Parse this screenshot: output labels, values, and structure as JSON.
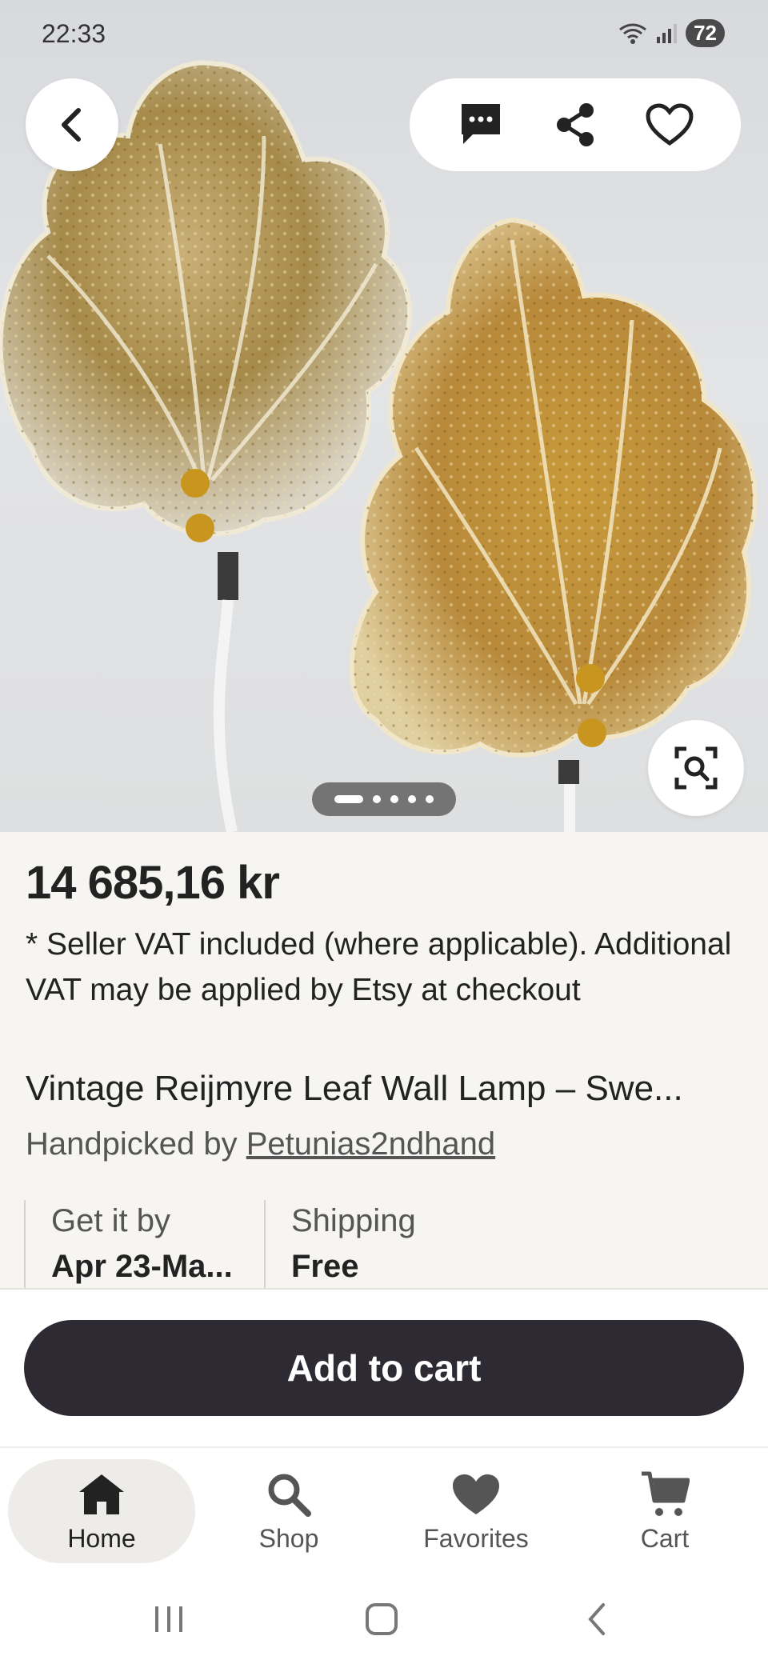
{
  "status_bar": {
    "time": "22:33",
    "battery": "72",
    "icons": [
      "wifi-icon",
      "signal-icon"
    ]
  },
  "top_actions": {
    "back_icon": "chevron-left-icon",
    "message_icon": "message-icon",
    "share_icon": "share-icon",
    "favorite_icon": "heart-outline-icon"
  },
  "gallery": {
    "image_count": 5,
    "current_index": 1,
    "zoom_icon": "visual-search-icon"
  },
  "listing": {
    "price": "14 685,16 kr",
    "vat_note": "* Seller VAT included (where applicable). Additional VAT may be applied by Etsy at checkout",
    "title": "Vintage Reijmyre Leaf Wall Lamp – Swe...",
    "handpicked_prefix": "Handpicked by ",
    "shop_name": "Petunias2ndhand"
  },
  "delivery": {
    "get_it_label": "Get it by",
    "get_it_value": "Apr 23-Ma...",
    "shipping_label": "Shipping",
    "shipping_value": "Free"
  },
  "cart": {
    "add_label": "Add to cart"
  },
  "bottom_nav": {
    "items": [
      {
        "label": "Home",
        "icon": "home-icon",
        "active": true
      },
      {
        "label": "Shop",
        "icon": "search-icon",
        "active": false
      },
      {
        "label": "Favorites",
        "icon": "heart-icon",
        "active": false
      },
      {
        "label": "Cart",
        "icon": "cart-icon",
        "active": false
      }
    ]
  },
  "colors": {
    "primary_button": "#2e2a33",
    "background": "#f6f5f2",
    "active_nav_bg": "#eeece8"
  }
}
